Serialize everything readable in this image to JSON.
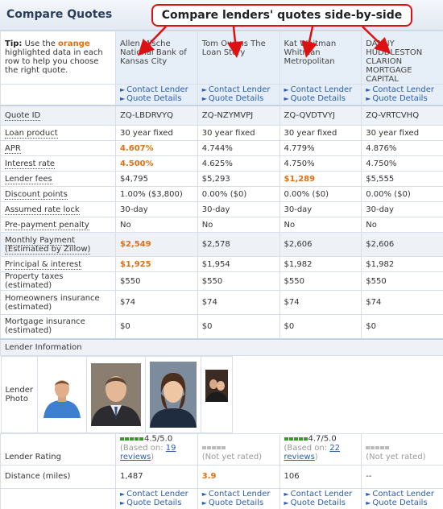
{
  "title": "Compare Quotes",
  "callout": "Compare lenders' quotes side-by-side",
  "tip": {
    "prefix": "Tip:",
    "text1": " Use the ",
    "orange": "orange",
    "text2": " highlighted data in each row to help you choose the right quote."
  },
  "links": {
    "contact": "Contact Lender",
    "details": "Quote Details"
  },
  "lenders": [
    {
      "name": "Allen Mische National Bank of Kansas City",
      "quote_id": "ZQ-LBDRVYQ",
      "product": "30 year fixed",
      "apr": "4.607%",
      "rate": "4.500%",
      "fees": "$4,795",
      "points": "1.00% ($3,800)",
      "lock": "30-day",
      "penalty": "No",
      "monthly": "$2,549",
      "principal": "$1,925",
      "tax": "$550",
      "home_ins": "$74",
      "mort_ins": "$0",
      "rating_value": "4.5/5.0",
      "rating_stars": 4.5,
      "based_prefix": "(Based on: ",
      "based_link": "19 reviews",
      "based_suffix": ")",
      "distance": "1,487"
    },
    {
      "name": "Tom Owens The Loan Story",
      "quote_id": "ZQ-NZYMVPJ",
      "product": "30 year fixed",
      "apr": "4.744%",
      "rate": "4.625%",
      "fees": "$5,293",
      "points": "0.00% ($0)",
      "lock": "30-day",
      "penalty": "No",
      "monthly": "$2,578",
      "principal": "$1,954",
      "tax": "$550",
      "home_ins": "$74",
      "mort_ins": "$0",
      "rating_text": "(Not yet rated)",
      "distance": "3.9"
    },
    {
      "name": "Kat Whitman Whitman Metropolitan",
      "quote_id": "ZQ-QVDTVYJ",
      "product": "30 year fixed",
      "apr": "4.779%",
      "rate": "4.750%",
      "fees": "$1,289",
      "points": "0.00% ($0)",
      "lock": "30-day",
      "penalty": "No",
      "monthly": "$2,606",
      "principal": "$1,982",
      "tax": "$550",
      "home_ins": "$74",
      "mort_ins": "$0",
      "rating_value": "4.7/5.0",
      "rating_stars": 4.7,
      "based_prefix": "(Based on: ",
      "based_link": "22 reviews",
      "based_suffix": ")",
      "distance": "106"
    },
    {
      "name": "DANNY HUDDLESTON CLARION MORTGAGE CAPITAL",
      "quote_id": "ZQ-VRTCVHQ",
      "product": "30 year fixed",
      "apr": "4.876%",
      "rate": "4.750%",
      "fees": "$5,555",
      "points": "0.00% ($0)",
      "lock": "30-day",
      "penalty": "No",
      "monthly": "$2,606",
      "principal": "$1,982",
      "tax": "$550",
      "home_ins": "$74",
      "mort_ins": "$0",
      "rating_text": "(Not yet rated)",
      "distance": "--"
    }
  ],
  "labels": {
    "quote_id": "Quote ID",
    "product": "Loan product",
    "apr": "APR",
    "rate": "Interest rate",
    "fees": "Lender fees",
    "points": "Discount points",
    "lock": "Assumed rate lock",
    "penalty": "Pre-payment penalty",
    "monthly": "Monthly Payment (Estimated by Zillow)",
    "principal": "Principal & interest",
    "tax": "Property taxes (estimated)",
    "home_ins": "Homeowners insurance (estimated)",
    "mort_ins": "Mortgage insurance (estimated)",
    "section": "Lender Information",
    "photo": "Lender Photo",
    "rating": "Lender Rating",
    "distance": "Distance (miles)"
  },
  "colors": {
    "orange": "#e07012",
    "link": "#2a5db0",
    "header_bg": "#e6eef7",
    "callout_border": "#dd1111",
    "rating_green": "#3a9b2b"
  }
}
